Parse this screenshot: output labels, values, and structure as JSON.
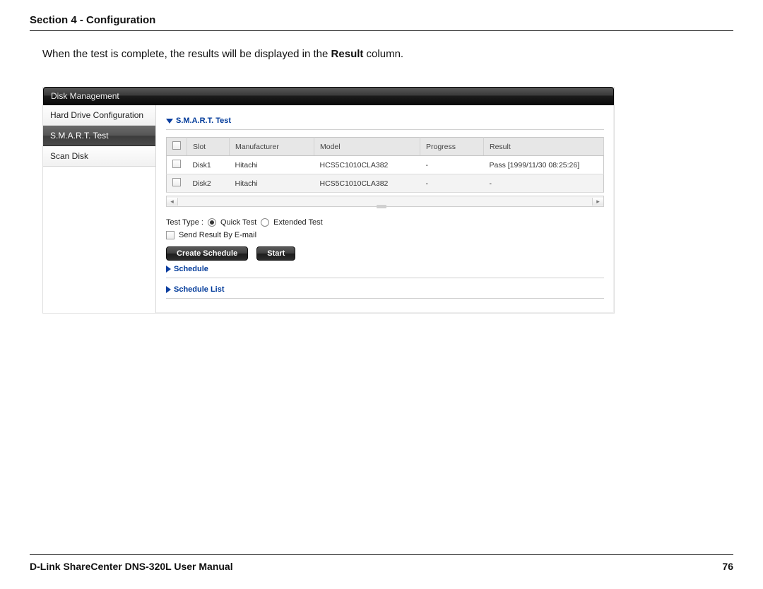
{
  "header": {
    "section": "Section 4 - Configuration"
  },
  "intro": {
    "pre": "When the test is complete, the results will be displayed in the ",
    "bold": "Result",
    "post": " column."
  },
  "app": {
    "title": "Disk Management",
    "sidebar": {
      "items": [
        {
          "label": "Hard Drive Configuration",
          "active": false
        },
        {
          "label": "S.M.A.R.T. Test",
          "active": true
        },
        {
          "label": "Scan Disk",
          "active": false
        }
      ]
    },
    "section": {
      "smart_label": "S.M.A.R.T. Test",
      "schedule_label": "Schedule",
      "schedule_list_label": "Schedule List"
    },
    "table": {
      "headers": {
        "slot": "Slot",
        "manufacturer": "Manufacturer",
        "model": "Model",
        "progress": "Progress",
        "result": "Result"
      },
      "rows": [
        {
          "slot": "Disk1",
          "manufacturer": "Hitachi",
          "model": "HCS5C1010CLA382",
          "progress": "-",
          "result": "Pass [1999/11/30 08:25:26]"
        },
        {
          "slot": "Disk2",
          "manufacturer": "Hitachi",
          "model": "HCS5C1010CLA382",
          "progress": "-",
          "result": "-"
        }
      ]
    },
    "opts": {
      "test_type_label": "Test Type :",
      "quick": "Quick Test",
      "extended": "Extended Test",
      "send_email": "Send Result By E-mail"
    },
    "buttons": {
      "create_schedule": "Create Schedule",
      "start": "Start"
    }
  },
  "footer": {
    "left": "D-Link ShareCenter DNS-320L User Manual",
    "right": "76"
  }
}
